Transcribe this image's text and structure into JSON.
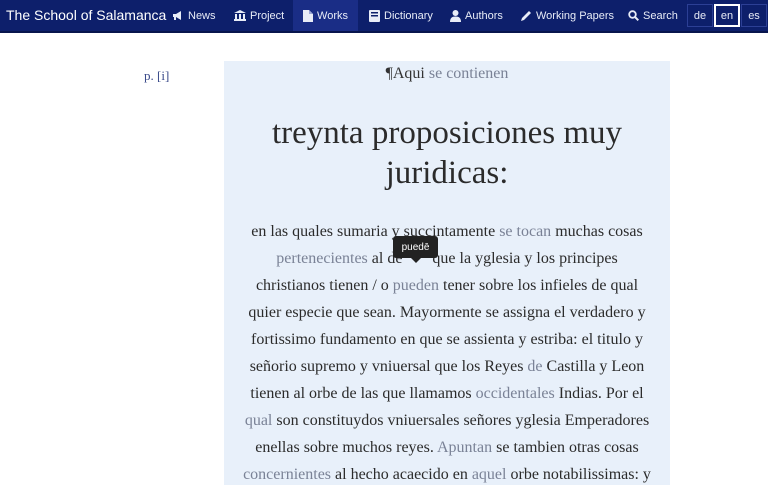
{
  "nav": {
    "brand": "The School of Salamanca",
    "items": [
      {
        "label": "News",
        "icon": "megaphone-icon"
      },
      {
        "label": "Project",
        "icon": "institution-icon"
      },
      {
        "label": "Works",
        "icon": "document-icon"
      },
      {
        "label": "Dictionary",
        "icon": "book-icon"
      },
      {
        "label": "Authors",
        "icon": "person-icon"
      },
      {
        "label": "Working Papers",
        "icon": "pencil-icon"
      },
      {
        "label": "Search",
        "icon": "search-icon"
      }
    ],
    "active_item": "Works",
    "languages": [
      "de",
      "en",
      "es"
    ],
    "active_language": "en"
  },
  "page_number": "p. [i]",
  "heading": {
    "prefix": "¶Aqui ",
    "rest_a": "se",
    "rest_b": " ",
    "rest_c": "contienen"
  },
  "title_line1": "treynta proposiciones muy",
  "title_line2": "juridicas:",
  "tooltip": "puedē",
  "lines": [
    {
      "a": "en las quales sumaria y succintamente ",
      "b": "se tocan",
      "c": " muchas cosas",
      "d": "",
      "e": ""
    },
    {
      "a": "",
      "b": "pertenecientes",
      "c": " al de",
      "d": "        ",
      "e": "que la yglesia y los principes"
    },
    {
      "a": "christianos tienen / o ",
      "b": "pueden",
      "c": " tener sobre los infieles de qual",
      "d": "",
      "e": ""
    },
    {
      "a": "quier especie que sean. Mayormente se assigna el verdadero y",
      "b": "",
      "c": "",
      "d": "",
      "e": ""
    },
    {
      "a": "fortissimo fundamento en que se assienta y estriba: el titulo y",
      "b": "",
      "c": "",
      "d": "",
      "e": ""
    },
    {
      "a": "señorio supremo y vniuersal que los Reyes ",
      "b": "de",
      "c": " Castilla y Leon",
      "d": "",
      "e": ""
    },
    {
      "a": "tienen al orbe de las que llamamos ",
      "b": "occidentales",
      "c": " Indias. Por el",
      "d": "",
      "e": ""
    },
    {
      "a": "",
      "b": "qual",
      "c": " son constituydos vniuersales señores yglesia Emperadores",
      "d": "",
      "e": ""
    },
    {
      "a": "enellas sobre muchos reyes. ",
      "b": "Apuntan",
      "c": " se tambien otras cosas",
      "d": "",
      "e": ""
    },
    {
      "a": "",
      "b": "concernientes",
      "c": " al hecho acaecido en ",
      "d": "aquel",
      "e": " orbe notabilissimas: y"
    }
  ]
}
